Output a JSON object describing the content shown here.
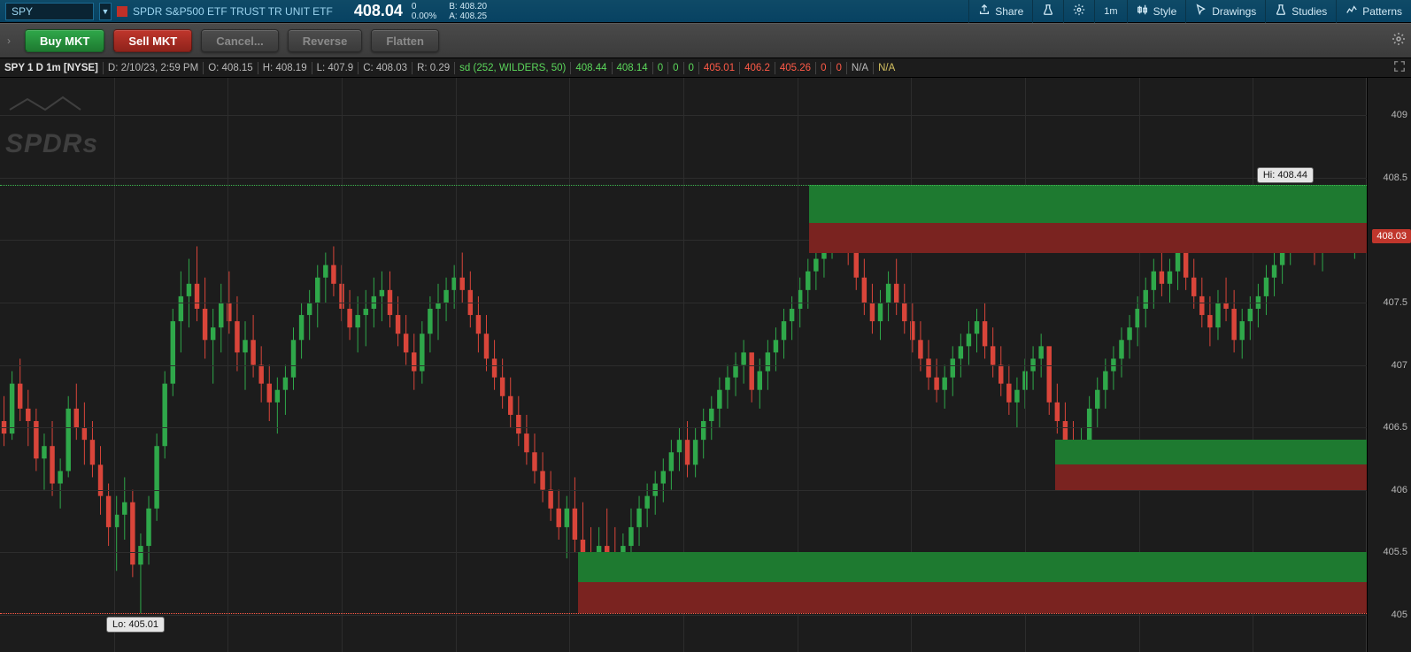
{
  "quote": {
    "symbol": "SPY",
    "name": "SPDR S&P500 ETF TRUST TR UNIT ETF",
    "last": "408.04",
    "chg_abs": "0",
    "chg_pct": "0.00%",
    "bid_label": "B:",
    "bid": "408.20",
    "ask_label": "A:",
    "ask": "408.25"
  },
  "toolbar": {
    "share": "Share",
    "timeframe": "1m",
    "style": "Style",
    "drawings": "Drawings",
    "studies": "Studies",
    "patterns": "Patterns"
  },
  "actions": {
    "buy": "Buy MKT",
    "sell": "Sell MKT",
    "cancel": "Cancel...",
    "reverse": "Reverse",
    "flatten": "Flatten"
  },
  "ohlc": {
    "header": "SPY 1 D 1m [NYSE]",
    "d_lbl": "D:",
    "d": "2/10/23, 2:59 PM",
    "o_lbl": "O:",
    "o": "408.15",
    "h_lbl": "H:",
    "h": "408.19",
    "l_lbl": "L:",
    "l": "407.9",
    "c_lbl": "C:",
    "c": "408.03",
    "r_lbl": "R:",
    "r": "0.29",
    "study": "sd (252, WILDERS, 50)",
    "sv1": "408.44",
    "sv2": "408.14",
    "z1": "0",
    "z2": "0",
    "z3": "0",
    "rv1": "405.01",
    "rv2": "406.2",
    "rv3": "405.26",
    "z4": "0",
    "z5": "0",
    "na1": "N/A",
    "na2": "N/A"
  },
  "yaxis": {
    "ticks": [
      "409",
      "408.5",
      "408",
      "407.5",
      "407",
      "406.5",
      "406",
      "405.5",
      "405"
    ],
    "price_tag": "408.03"
  },
  "markers": {
    "hi_label": "Hi: 408.44",
    "lo_label": "Lo: 405.01"
  },
  "watermark": "SPDRs",
  "chart_data": {
    "type": "candlestick",
    "ylim": [
      404.7,
      409.3
    ],
    "y_ticks": [
      409,
      408.5,
      408,
      407.5,
      407,
      406.5,
      406,
      405.5,
      405
    ],
    "hi": 408.44,
    "lo": 405.01,
    "last": 408.03,
    "zones": [
      {
        "x_frac_start": 0.423,
        "top": 405.5,
        "mid": 405.26,
        "bot": 405.01
      },
      {
        "x_frac_start": 0.592,
        "top": 408.44,
        "mid": 408.14,
        "bot": 407.9
      },
      {
        "x_frac_start": 0.772,
        "top": 406.4,
        "mid": 406.2,
        "bot": 406.0
      }
    ],
    "candles": [
      {
        "o": 406.55,
        "h": 406.75,
        "l": 406.35,
        "c": 406.45
      },
      {
        "o": 406.45,
        "h": 406.95,
        "l": 406.4,
        "c": 406.85
      },
      {
        "o": 406.85,
        "h": 407.05,
        "l": 406.55,
        "c": 406.65
      },
      {
        "o": 406.65,
        "h": 406.8,
        "l": 406.35,
        "c": 406.55
      },
      {
        "o": 406.55,
        "h": 406.65,
        "l": 406.15,
        "c": 406.25
      },
      {
        "o": 406.25,
        "h": 406.45,
        "l": 406.0,
        "c": 406.35
      },
      {
        "o": 406.35,
        "h": 406.55,
        "l": 405.95,
        "c": 406.05
      },
      {
        "o": 406.05,
        "h": 406.25,
        "l": 405.85,
        "c": 406.15
      },
      {
        "o": 406.15,
        "h": 406.75,
        "l": 406.1,
        "c": 406.65
      },
      {
        "o": 406.65,
        "h": 406.85,
        "l": 406.4,
        "c": 406.5
      },
      {
        "o": 406.5,
        "h": 406.7,
        "l": 406.2,
        "c": 406.4
      },
      {
        "o": 406.4,
        "h": 406.55,
        "l": 406.1,
        "c": 406.2
      },
      {
        "o": 406.2,
        "h": 406.35,
        "l": 405.8,
        "c": 405.95
      },
      {
        "o": 405.95,
        "h": 406.05,
        "l": 405.55,
        "c": 405.7
      },
      {
        "o": 405.7,
        "h": 405.95,
        "l": 405.35,
        "c": 405.8
      },
      {
        "o": 405.8,
        "h": 406.1,
        "l": 405.6,
        "c": 405.9
      },
      {
        "o": 405.9,
        "h": 406.0,
        "l": 405.3,
        "c": 405.4
      },
      {
        "o": 405.4,
        "h": 405.65,
        "l": 405.01,
        "c": 405.55
      },
      {
        "o": 405.55,
        "h": 405.95,
        "l": 405.4,
        "c": 405.85
      },
      {
        "o": 405.85,
        "h": 406.45,
        "l": 405.75,
        "c": 406.35
      },
      {
        "o": 406.35,
        "h": 406.95,
        "l": 406.25,
        "c": 406.85
      },
      {
        "o": 406.85,
        "h": 407.45,
        "l": 406.75,
        "c": 407.35
      },
      {
        "o": 407.35,
        "h": 407.75,
        "l": 407.1,
        "c": 407.55
      },
      {
        "o": 407.55,
        "h": 407.85,
        "l": 407.3,
        "c": 407.65
      },
      {
        "o": 407.65,
        "h": 407.95,
        "l": 407.35,
        "c": 407.45
      },
      {
        "o": 407.45,
        "h": 407.7,
        "l": 407.05,
        "c": 407.2
      },
      {
        "o": 407.2,
        "h": 407.45,
        "l": 406.85,
        "c": 407.3
      },
      {
        "o": 407.3,
        "h": 407.65,
        "l": 407.1,
        "c": 407.5
      },
      {
        "o": 407.5,
        "h": 407.75,
        "l": 407.25,
        "c": 407.35
      },
      {
        "o": 407.35,
        "h": 407.55,
        "l": 406.95,
        "c": 407.1
      },
      {
        "o": 407.1,
        "h": 407.35,
        "l": 406.8,
        "c": 407.2
      },
      {
        "o": 407.2,
        "h": 407.4,
        "l": 406.9,
        "c": 407.0
      },
      {
        "o": 407.0,
        "h": 407.15,
        "l": 406.7,
        "c": 406.85
      },
      {
        "o": 406.85,
        "h": 407.0,
        "l": 406.55,
        "c": 406.7
      },
      {
        "o": 406.7,
        "h": 406.9,
        "l": 406.45,
        "c": 406.8
      },
      {
        "o": 406.8,
        "h": 407.0,
        "l": 406.6,
        "c": 406.9
      },
      {
        "o": 406.9,
        "h": 407.3,
        "l": 406.8,
        "c": 407.2
      },
      {
        "o": 407.2,
        "h": 407.5,
        "l": 407.05,
        "c": 407.4
      },
      {
        "o": 407.4,
        "h": 407.6,
        "l": 407.2,
        "c": 407.5
      },
      {
        "o": 407.5,
        "h": 407.8,
        "l": 407.3,
        "c": 407.7
      },
      {
        "o": 407.7,
        "h": 407.9,
        "l": 407.5,
        "c": 407.8
      },
      {
        "o": 407.8,
        "h": 407.95,
        "l": 407.55,
        "c": 407.65
      },
      {
        "o": 407.65,
        "h": 407.8,
        "l": 407.35,
        "c": 407.45
      },
      {
        "o": 407.45,
        "h": 407.6,
        "l": 407.2,
        "c": 407.3
      },
      {
        "o": 407.3,
        "h": 407.55,
        "l": 407.1,
        "c": 407.4
      },
      {
        "o": 407.4,
        "h": 407.6,
        "l": 407.15,
        "c": 407.45
      },
      {
        "o": 407.45,
        "h": 407.7,
        "l": 407.3,
        "c": 407.55
      },
      {
        "o": 407.55,
        "h": 407.75,
        "l": 407.35,
        "c": 407.6
      },
      {
        "o": 407.6,
        "h": 407.75,
        "l": 407.3,
        "c": 407.4
      },
      {
        "o": 407.4,
        "h": 407.55,
        "l": 407.15,
        "c": 407.25
      },
      {
        "o": 407.25,
        "h": 407.4,
        "l": 407.0,
        "c": 407.1
      },
      {
        "o": 407.1,
        "h": 407.25,
        "l": 406.8,
        "c": 406.95
      },
      {
        "o": 406.95,
        "h": 407.35,
        "l": 406.85,
        "c": 407.25
      },
      {
        "o": 407.25,
        "h": 407.55,
        "l": 407.1,
        "c": 407.45
      },
      {
        "o": 407.45,
        "h": 407.65,
        "l": 407.2,
        "c": 407.5
      },
      {
        "o": 407.5,
        "h": 407.7,
        "l": 407.35,
        "c": 407.6
      },
      {
        "o": 407.6,
        "h": 407.8,
        "l": 407.45,
        "c": 407.7
      },
      {
        "o": 407.7,
        "h": 407.9,
        "l": 407.5,
        "c": 407.6
      },
      {
        "o": 407.6,
        "h": 407.75,
        "l": 407.3,
        "c": 407.4
      },
      {
        "o": 407.4,
        "h": 407.55,
        "l": 407.1,
        "c": 407.25
      },
      {
        "o": 407.25,
        "h": 407.4,
        "l": 406.95,
        "c": 407.05
      },
      {
        "o": 407.05,
        "h": 407.2,
        "l": 406.8,
        "c": 406.9
      },
      {
        "o": 406.9,
        "h": 407.05,
        "l": 406.65,
        "c": 406.75
      },
      {
        "o": 406.75,
        "h": 406.9,
        "l": 406.5,
        "c": 406.6
      },
      {
        "o": 406.6,
        "h": 406.75,
        "l": 406.35,
        "c": 406.45
      },
      {
        "o": 406.45,
        "h": 406.6,
        "l": 406.2,
        "c": 406.3
      },
      {
        "o": 406.3,
        "h": 406.45,
        "l": 406.05,
        "c": 406.15
      },
      {
        "o": 406.15,
        "h": 406.3,
        "l": 405.9,
        "c": 406.0
      },
      {
        "o": 406.0,
        "h": 406.15,
        "l": 405.75,
        "c": 405.85
      },
      {
        "o": 405.85,
        "h": 406.0,
        "l": 405.6,
        "c": 405.7
      },
      {
        "o": 405.7,
        "h": 405.95,
        "l": 405.45,
        "c": 405.85
      },
      {
        "o": 405.85,
        "h": 406.1,
        "l": 405.5,
        "c": 405.6
      },
      {
        "o": 405.6,
        "h": 405.9,
        "l": 405.3,
        "c": 405.4
      },
      {
        "o": 405.4,
        "h": 405.7,
        "l": 405.15,
        "c": 405.3
      },
      {
        "o": 405.3,
        "h": 405.7,
        "l": 405.2,
        "c": 405.55
      },
      {
        "o": 405.55,
        "h": 405.85,
        "l": 405.35,
        "c": 405.5
      },
      {
        "o": 405.5,
        "h": 405.7,
        "l": 405.3,
        "c": 405.45
      },
      {
        "o": 405.45,
        "h": 405.65,
        "l": 405.25,
        "c": 405.55
      },
      {
        "o": 405.55,
        "h": 405.85,
        "l": 405.4,
        "c": 405.7
      },
      {
        "o": 405.7,
        "h": 405.95,
        "l": 405.55,
        "c": 405.85
      },
      {
        "o": 405.85,
        "h": 406.05,
        "l": 405.7,
        "c": 405.95
      },
      {
        "o": 405.95,
        "h": 406.15,
        "l": 405.8,
        "c": 406.05
      },
      {
        "o": 406.05,
        "h": 406.25,
        "l": 405.9,
        "c": 406.15
      },
      {
        "o": 406.15,
        "h": 406.4,
        "l": 406.0,
        "c": 406.3
      },
      {
        "o": 406.3,
        "h": 406.5,
        "l": 406.15,
        "c": 406.4
      },
      {
        "o": 406.4,
        "h": 406.55,
        "l": 406.1,
        "c": 406.2
      },
      {
        "o": 406.2,
        "h": 406.5,
        "l": 406.1,
        "c": 406.4
      },
      {
        "o": 406.4,
        "h": 406.65,
        "l": 406.25,
        "c": 406.55
      },
      {
        "o": 406.55,
        "h": 406.75,
        "l": 406.4,
        "c": 406.65
      },
      {
        "o": 406.65,
        "h": 406.9,
        "l": 406.5,
        "c": 406.8
      },
      {
        "o": 406.8,
        "h": 407.0,
        "l": 406.65,
        "c": 406.9
      },
      {
        "o": 406.9,
        "h": 407.1,
        "l": 406.75,
        "c": 407.0
      },
      {
        "o": 407.0,
        "h": 407.2,
        "l": 406.85,
        "c": 407.1
      },
      {
        "o": 407.1,
        "h": 406.95,
        "l": 406.7,
        "c": 406.8
      },
      {
        "o": 406.8,
        "h": 407.05,
        "l": 406.65,
        "c": 406.95
      },
      {
        "o": 406.95,
        "h": 407.2,
        "l": 406.8,
        "c": 407.1
      },
      {
        "o": 407.1,
        "h": 407.3,
        "l": 406.95,
        "c": 407.2
      },
      {
        "o": 407.2,
        "h": 407.45,
        "l": 407.05,
        "c": 407.35
      },
      {
        "o": 407.35,
        "h": 407.55,
        "l": 407.2,
        "c": 407.45
      },
      {
        "o": 407.45,
        "h": 407.7,
        "l": 407.3,
        "c": 407.6
      },
      {
        "o": 407.6,
        "h": 407.85,
        "l": 407.45,
        "c": 407.75
      },
      {
        "o": 407.75,
        "h": 407.95,
        "l": 407.6,
        "c": 407.85
      },
      {
        "o": 407.85,
        "h": 408.1,
        "l": 407.7,
        "c": 408.0
      },
      {
        "o": 408.0,
        "h": 408.3,
        "l": 407.85,
        "c": 408.2
      },
      {
        "o": 408.2,
        "h": 408.44,
        "l": 408.0,
        "c": 408.1
      },
      {
        "o": 408.1,
        "h": 408.25,
        "l": 407.8,
        "c": 407.9
      },
      {
        "o": 407.9,
        "h": 408.05,
        "l": 407.6,
        "c": 407.7
      },
      {
        "o": 407.7,
        "h": 407.85,
        "l": 407.4,
        "c": 407.5
      },
      {
        "o": 407.5,
        "h": 407.65,
        "l": 407.25,
        "c": 407.35
      },
      {
        "o": 407.35,
        "h": 407.6,
        "l": 407.2,
        "c": 407.5
      },
      {
        "o": 407.5,
        "h": 407.75,
        "l": 407.35,
        "c": 407.65
      },
      {
        "o": 407.65,
        "h": 407.85,
        "l": 407.4,
        "c": 407.5
      },
      {
        "o": 407.5,
        "h": 407.65,
        "l": 407.25,
        "c": 407.35
      },
      {
        "o": 407.35,
        "h": 407.5,
        "l": 407.1,
        "c": 407.2
      },
      {
        "o": 407.2,
        "h": 407.35,
        "l": 406.95,
        "c": 407.05
      },
      {
        "o": 407.05,
        "h": 407.2,
        "l": 406.8,
        "c": 406.9
      },
      {
        "o": 406.9,
        "h": 407.05,
        "l": 406.7,
        "c": 406.8
      },
      {
        "o": 406.8,
        "h": 407.0,
        "l": 406.65,
        "c": 406.9
      },
      {
        "o": 406.9,
        "h": 407.15,
        "l": 406.75,
        "c": 407.05
      },
      {
        "o": 407.05,
        "h": 407.25,
        "l": 406.9,
        "c": 407.15
      },
      {
        "o": 407.15,
        "h": 407.35,
        "l": 407.0,
        "c": 407.25
      },
      {
        "o": 407.25,
        "h": 407.45,
        "l": 407.1,
        "c": 407.35
      },
      {
        "o": 407.35,
        "h": 407.5,
        "l": 407.05,
        "c": 407.15
      },
      {
        "o": 407.15,
        "h": 407.3,
        "l": 406.9,
        "c": 407.0
      },
      {
        "o": 407.0,
        "h": 407.15,
        "l": 406.75,
        "c": 406.85
      },
      {
        "o": 406.85,
        "h": 407.0,
        "l": 406.6,
        "c": 406.7
      },
      {
        "o": 406.7,
        "h": 406.9,
        "l": 406.5,
        "c": 406.8
      },
      {
        "o": 406.8,
        "h": 407.05,
        "l": 406.65,
        "c": 406.95
      },
      {
        "o": 406.95,
        "h": 407.15,
        "l": 406.8,
        "c": 407.05
      },
      {
        "o": 407.05,
        "h": 407.25,
        "l": 406.9,
        "c": 407.15
      },
      {
        "o": 407.15,
        "h": 407.05,
        "l": 406.6,
        "c": 406.7
      },
      {
        "o": 406.7,
        "h": 406.85,
        "l": 406.45,
        "c": 406.55
      },
      {
        "o": 406.55,
        "h": 406.7,
        "l": 406.3,
        "c": 406.4
      },
      {
        "o": 406.4,
        "h": 406.55,
        "l": 406.05,
        "c": 406.15
      },
      {
        "o": 406.15,
        "h": 406.5,
        "l": 406.05,
        "c": 406.4
      },
      {
        "o": 406.4,
        "h": 406.75,
        "l": 406.25,
        "c": 406.65
      },
      {
        "o": 406.65,
        "h": 406.9,
        "l": 406.5,
        "c": 406.8
      },
      {
        "o": 406.8,
        "h": 407.05,
        "l": 406.65,
        "c": 406.95
      },
      {
        "o": 406.95,
        "h": 407.15,
        "l": 406.8,
        "c": 407.05
      },
      {
        "o": 407.05,
        "h": 407.3,
        "l": 406.9,
        "c": 407.2
      },
      {
        "o": 407.2,
        "h": 407.4,
        "l": 407.05,
        "c": 407.3
      },
      {
        "o": 407.3,
        "h": 407.55,
        "l": 407.15,
        "c": 407.45
      },
      {
        "o": 407.45,
        "h": 407.7,
        "l": 407.3,
        "c": 407.6
      },
      {
        "o": 407.6,
        "h": 407.85,
        "l": 407.45,
        "c": 407.75
      },
      {
        "o": 407.75,
        "h": 407.95,
        "l": 407.55,
        "c": 407.65
      },
      {
        "o": 407.65,
        "h": 407.85,
        "l": 407.5,
        "c": 407.75
      },
      {
        "o": 407.75,
        "h": 408.0,
        "l": 407.6,
        "c": 407.9
      },
      {
        "o": 407.9,
        "h": 408.05,
        "l": 407.6,
        "c": 407.7
      },
      {
        "o": 407.7,
        "h": 407.85,
        "l": 407.45,
        "c": 407.55
      },
      {
        "o": 407.55,
        "h": 407.7,
        "l": 407.3,
        "c": 407.4
      },
      {
        "o": 407.4,
        "h": 407.55,
        "l": 407.15,
        "c": 407.3
      },
      {
        "o": 407.3,
        "h": 407.6,
        "l": 407.2,
        "c": 407.5
      },
      {
        "o": 407.5,
        "h": 407.7,
        "l": 407.35,
        "c": 407.45
      },
      {
        "o": 407.45,
        "h": 407.6,
        "l": 407.1,
        "c": 407.2
      },
      {
        "o": 407.2,
        "h": 407.45,
        "l": 407.05,
        "c": 407.35
      },
      {
        "o": 407.35,
        "h": 407.55,
        "l": 407.2,
        "c": 407.45
      },
      {
        "o": 407.45,
        "h": 407.65,
        "l": 407.3,
        "c": 407.55
      },
      {
        "o": 407.55,
        "h": 407.8,
        "l": 407.4,
        "c": 407.7
      },
      {
        "o": 407.7,
        "h": 407.9,
        "l": 407.55,
        "c": 407.8
      },
      {
        "o": 407.8,
        "h": 408.05,
        "l": 407.65,
        "c": 407.95
      },
      {
        "o": 407.95,
        "h": 408.15,
        "l": 407.8,
        "c": 408.05
      },
      {
        "o": 408.05,
        "h": 408.25,
        "l": 407.9,
        "c": 408.15
      },
      {
        "o": 408.15,
        "h": 408.35,
        "l": 407.95,
        "c": 408.05
      },
      {
        "o": 408.05,
        "h": 408.2,
        "l": 407.8,
        "c": 407.9
      },
      {
        "o": 407.9,
        "h": 408.15,
        "l": 407.75,
        "c": 408.05
      },
      {
        "o": 408.05,
        "h": 408.3,
        "l": 407.9,
        "c": 408.2
      },
      {
        "o": 408.2,
        "h": 408.44,
        "l": 408.0,
        "c": 408.3
      },
      {
        "o": 408.3,
        "h": 408.4,
        "l": 407.95,
        "c": 408.05
      },
      {
        "o": 408.05,
        "h": 408.2,
        "l": 407.85,
        "c": 408.1
      },
      {
        "o": 408.15,
        "h": 408.19,
        "l": 407.9,
        "c": 408.03
      }
    ]
  }
}
